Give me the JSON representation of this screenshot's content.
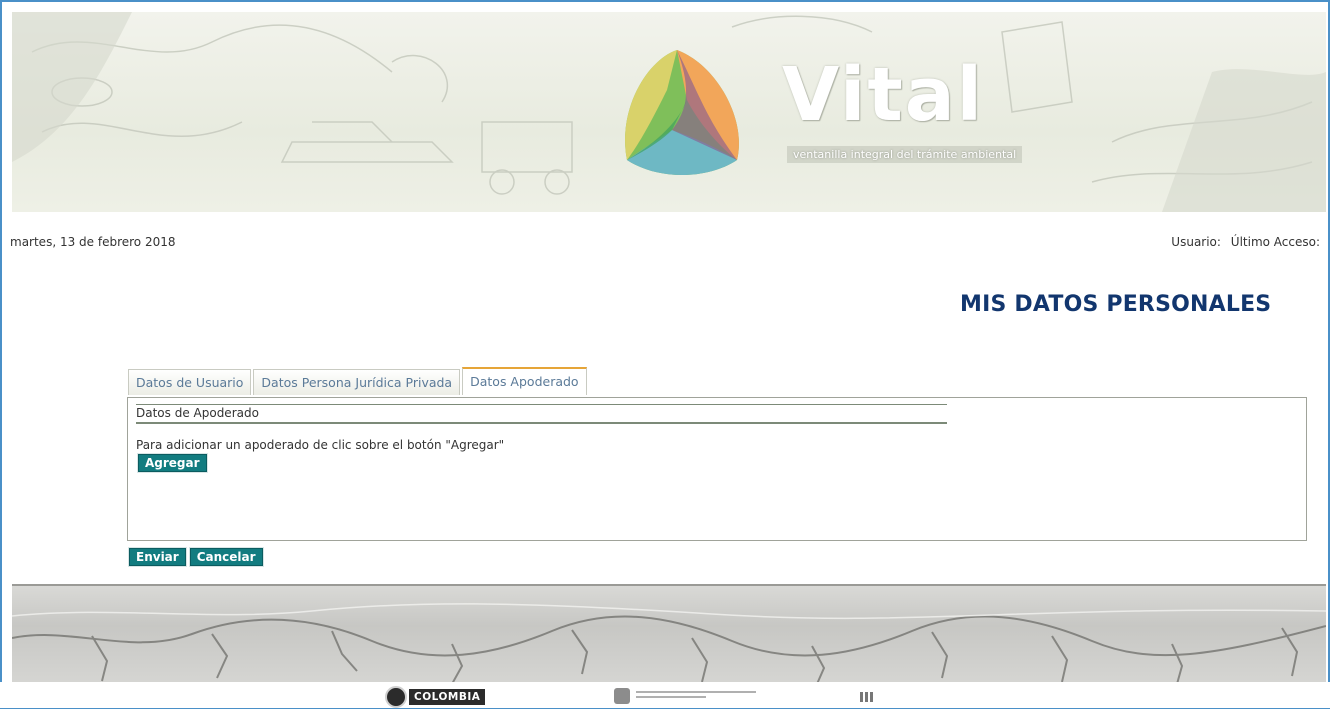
{
  "header": {
    "brand_name": "Vital",
    "brand_tagline": "ventanilla integral del trámite ambiental",
    "date": "martes, 13 de febrero 2018",
    "user_label": "Usuario:",
    "last_access_label": "Último Acceso:"
  },
  "page": {
    "title": "MIS DATOS PERSONALES"
  },
  "tabs": [
    {
      "label": "Datos de Usuario",
      "active": false
    },
    {
      "label": "Datos Persona Jurídica Privada",
      "active": false
    },
    {
      "label": "Datos Apoderado",
      "active": true
    }
  ],
  "panel": {
    "section_title": "Datos de Apoderado",
    "instruction": "Para adicionar un apoderado de clic sobre el botón \"Agregar\"",
    "add_button": "Agregar"
  },
  "actions": {
    "submit_button": "Enviar",
    "cancel_button": "Cancelar"
  },
  "footer": {
    "colombia_logo_text": "COLOMBIA"
  },
  "colors": {
    "title": "#12366e",
    "button": "#127c80",
    "active_tab_accent": "#e6a538",
    "tab_text": "#5b7a98"
  }
}
